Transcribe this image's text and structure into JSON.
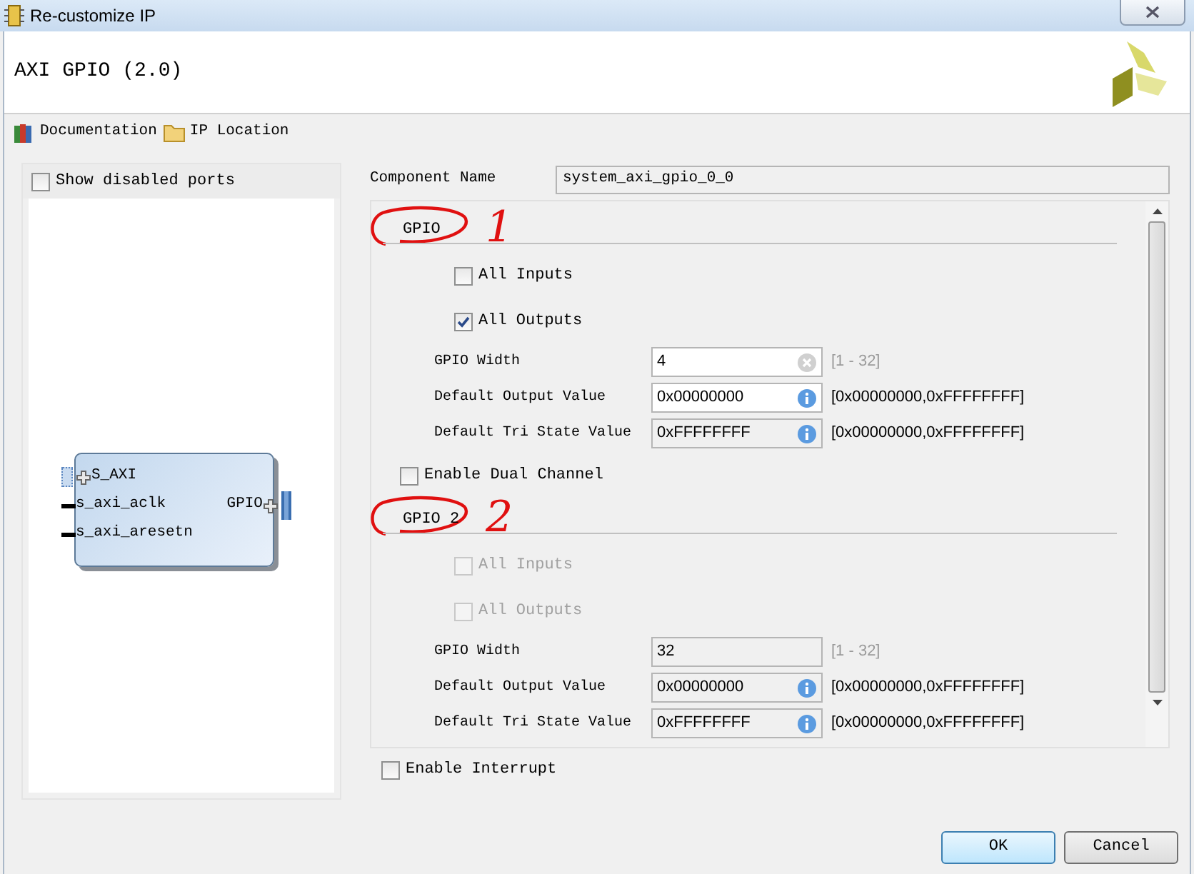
{
  "window": {
    "title": "Re-customize IP"
  },
  "header": {
    "title": "AXI GPIO (2.0)"
  },
  "toolbar": [
    {
      "kind": "book",
      "label": "Documentation"
    },
    {
      "kind": "folder",
      "label": "IP Location"
    }
  ],
  "left_panel": {
    "show_disabled_ports": {
      "label": "Show disabled ports",
      "checked": false
    },
    "block": {
      "left_ports": [
        {
          "kind": "bus",
          "label": "S_AXI"
        },
        {
          "kind": "wire",
          "label": "s_axi_aclk"
        },
        {
          "kind": "wire",
          "label": "s_axi_aresetn"
        }
      ],
      "right_ports": [
        {
          "kind": "bus",
          "label": "GPIO"
        }
      ]
    }
  },
  "settings": {
    "component_name": {
      "label": "Component Name",
      "value": "system_axi_gpio_0_0"
    },
    "sections": [
      {
        "kind": "group",
        "title": "GPIO",
        "annotation": "1",
        "checkboxes": [
          {
            "label": "All Inputs",
            "checked": false,
            "disabled": false
          },
          {
            "label": "All Outputs",
            "checked": true,
            "disabled": false
          }
        ],
        "fields": [
          {
            "label": "GPIO Width",
            "value": "4",
            "editable": true,
            "kind": "clear",
            "range": "[1 - 32]",
            "range_disabled": true
          },
          {
            "label": "Default Output Value",
            "value": "0x00000000",
            "editable": true,
            "kind": "info",
            "range": "[0x00000000,0xFFFFFFFF]",
            "range_disabled": false
          },
          {
            "label": "Default Tri State Value",
            "value": "0xFFFFFFFF",
            "editable": false,
            "kind": "info",
            "range": "[0x00000000,0xFFFFFFFF]",
            "range_disabled": false
          }
        ]
      },
      {
        "kind": "checkbox",
        "label": "Enable Dual Channel",
        "checked": false
      },
      {
        "kind": "group",
        "title": "GPIO 2",
        "annotation": "2",
        "checkboxes": [
          {
            "label": "All Inputs",
            "checked": false,
            "disabled": true
          },
          {
            "label": "All Outputs",
            "checked": false,
            "disabled": true
          }
        ],
        "fields": [
          {
            "label": "GPIO Width",
            "value": "32",
            "editable": false,
            "kind": "plain",
            "range": "[1 - 32]",
            "range_disabled": true
          },
          {
            "label": "Default Output Value",
            "value": "0x00000000",
            "editable": false,
            "kind": "info",
            "range": "[0x00000000,0xFFFFFFFF]",
            "range_disabled": false
          },
          {
            "label": "Default Tri State Value",
            "value": "0xFFFFFFFF",
            "editable": false,
            "kind": "info",
            "range": "[0x00000000,0xFFFFFFFF]",
            "range_disabled": false
          }
        ]
      }
    ],
    "enable_interrupt": {
      "label": "Enable Interrupt",
      "checked": false
    }
  },
  "buttons": [
    {
      "label": "OK",
      "default": true
    },
    {
      "label": "Cancel",
      "default": false
    }
  ]
}
